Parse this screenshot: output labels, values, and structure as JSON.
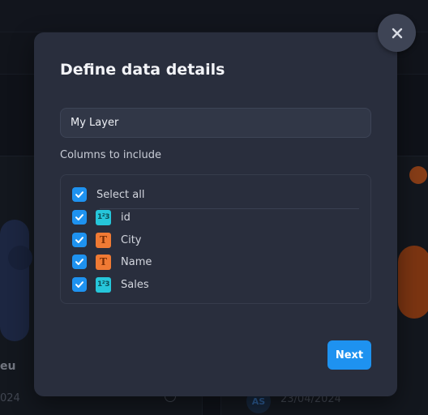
{
  "background": {
    "card_left_label": "eu",
    "card_left_date": "024",
    "card_right_avatar": "AS",
    "card_right_date": "23/04/2024"
  },
  "modal": {
    "title": "Define data details",
    "layer_name_value": "My Layer",
    "columns_label": "Columns to include",
    "select_all_label": "Select all",
    "columns": [
      {
        "name": "id",
        "type": "number",
        "type_glyph": "1²3",
        "checked": true
      },
      {
        "name": "City",
        "type": "text",
        "type_glyph": "T",
        "checked": true
      },
      {
        "name": "Name",
        "type": "text",
        "type_glyph": "T",
        "checked": true
      },
      {
        "name": "Sales",
        "type": "number",
        "type_glyph": "1²3",
        "checked": true
      }
    ],
    "next_label": "Next",
    "close_icon": "close-icon"
  },
  "colors": {
    "accent": "#1e92f0",
    "modal_bg": "#292e3d",
    "number_type": "#26c6da",
    "text_type": "#f07a34"
  }
}
